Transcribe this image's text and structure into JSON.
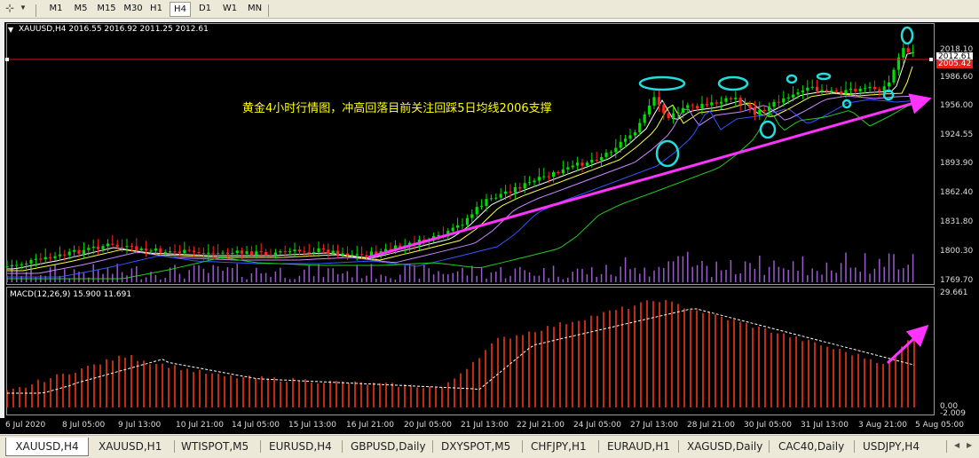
{
  "toolbar": {
    "timeframes": [
      "M1",
      "M5",
      "M15",
      "M30",
      "H1",
      "H4",
      "D1",
      "W1",
      "MN"
    ],
    "active_timeframe": "H4"
  },
  "chart": {
    "header": "XAUUSD,H4  2016.55 2016.92 2011.25 2012.61",
    "annotation": "黄金4小时行情图，冲高回落目前关注回踩5日均线2006支撑",
    "macd_header": "MACD(12,26,9) 15.900 11.691",
    "price_ticks": [
      "2018.10",
      "1986.60",
      "1956.00",
      "1924.55",
      "1893.90",
      "1862.40",
      "1831.80",
      "1800.30",
      "1769.70"
    ],
    "current_price_label": "2012.61",
    "line_price_label": "2005.42",
    "macd_ticks": [
      "29.661",
      "0.00",
      "-2.009"
    ],
    "date_ticks": [
      "6 Jul 2020",
      "8 Jul 05:00",
      "9 Jul 13:00",
      "10 Jul 21:00",
      "14 Jul 05:00",
      "15 Jul 13:00",
      "16 Jul 21:00",
      "20 Jul 05:00",
      "21 Jul 13:00",
      "22 Jul 21:00",
      "24 Jul 05:00",
      "27 Jul 13:00",
      "28 Jul 21:00",
      "30 Jul 05:00",
      "31 Jul 13:00",
      "3 Aug 21:00",
      "5 Aug 05:00"
    ],
    "colors": {
      "background": "#000000",
      "bull": "#00dd00",
      "bear": "#ff2020",
      "annotation": "#ffff00",
      "trend_arrow": "#ff33ff",
      "circles": "#22dddd",
      "volume": "#9a5ad0",
      "macd_hist": "#ff3b1a",
      "signal": "#ffffff"
    }
  },
  "tabs": [
    {
      "label": "XAUUSD,H4",
      "active": true
    },
    {
      "label": "XAUUSD,H1",
      "active": false
    },
    {
      "label": "WTISPOT,M5",
      "active": false
    },
    {
      "label": "EURUSD,H4",
      "active": false
    },
    {
      "label": "GBPUSD,Daily",
      "active": false
    },
    {
      "label": "DXYSPOT,M5",
      "active": false
    },
    {
      "label": "CHFJPY,H1",
      "active": false
    },
    {
      "label": "EURAUD,H1",
      "active": false
    },
    {
      "label": "XAGUSD,Daily",
      "active": false
    },
    {
      "label": "CAC40,Daily",
      "active": false
    },
    {
      "label": "USDJPY,H4",
      "active": false
    }
  ]
}
